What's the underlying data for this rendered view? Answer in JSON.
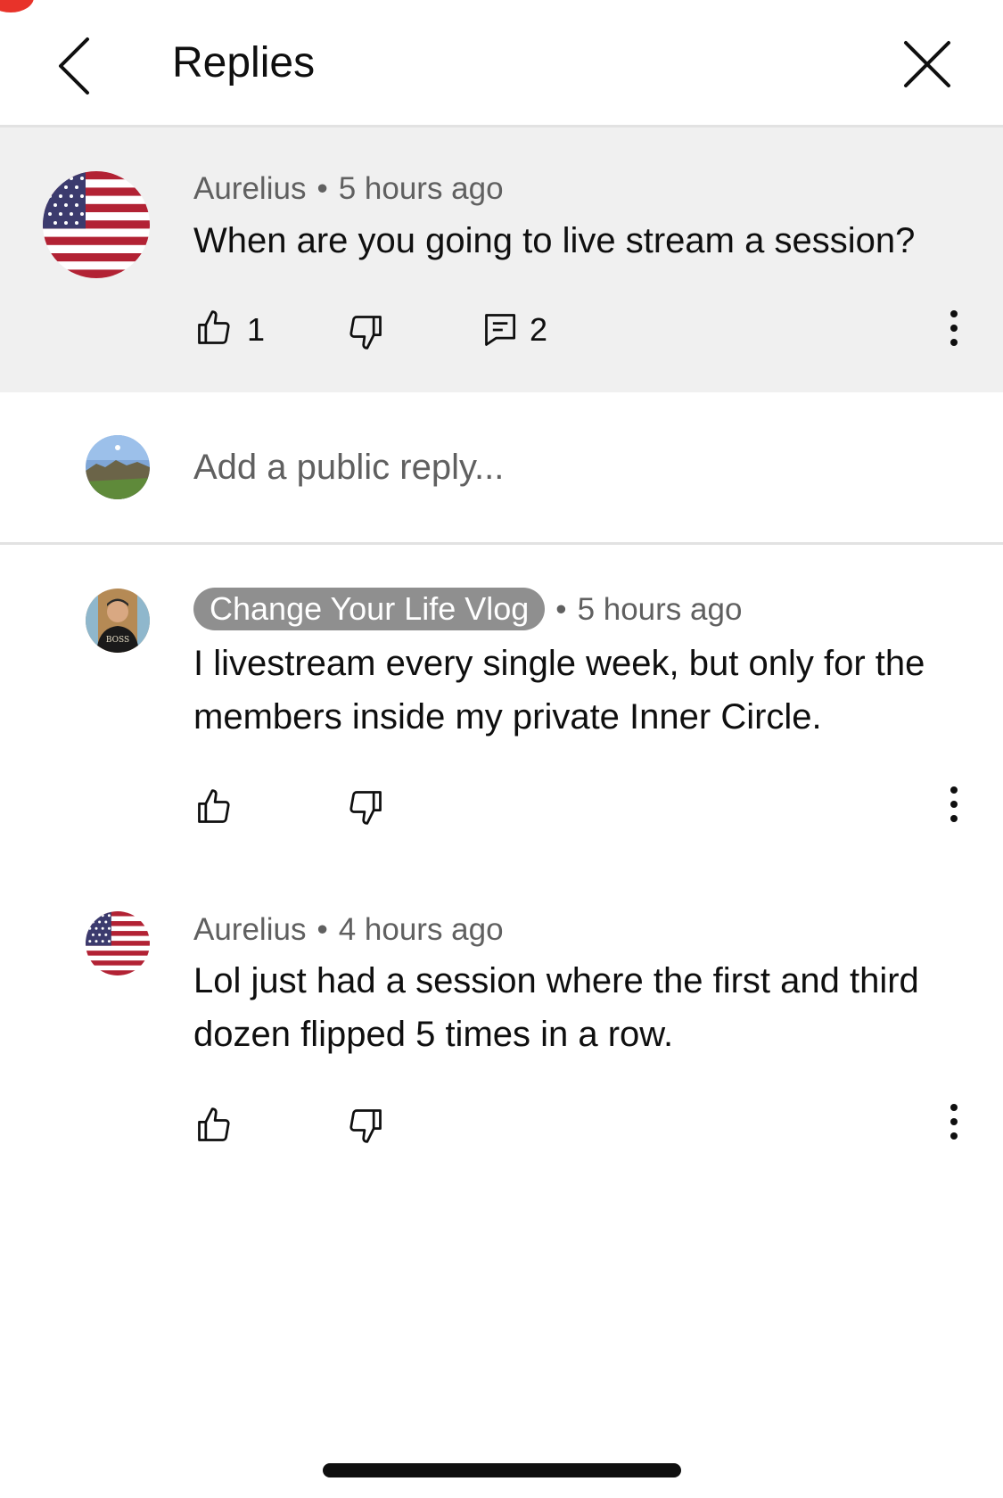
{
  "header": {
    "title": "Replies"
  },
  "parent_comment": {
    "author": "Aurelius",
    "time": "5 hours ago",
    "text": "When are you going to live stream a session?",
    "likes": "1",
    "replies": "2"
  },
  "reply_input": {
    "placeholder": "Add a public reply..."
  },
  "replies": [
    {
      "author": "Change Your Life Vlog",
      "time": "5 hours ago",
      "text": "I livestream every single week, but only for the members inside my private Inner Circle.",
      "is_creator": true,
      "avatar_shirt_text": "BOSS"
    },
    {
      "author": "Aurelius",
      "time": "4 hours ago",
      "text": "Lol just had a session where the first and third dozen flipped 5 times in a row."
    }
  ],
  "colors": {
    "text": "#0f0f0f",
    "secondary": "#606060",
    "highlight_bg": "#f0f0f0",
    "badge_bg": "#8f8f8f",
    "flag_red": "#b22234",
    "flag_blue": "#3c3b6e",
    "record_dot": "#e8332a"
  }
}
